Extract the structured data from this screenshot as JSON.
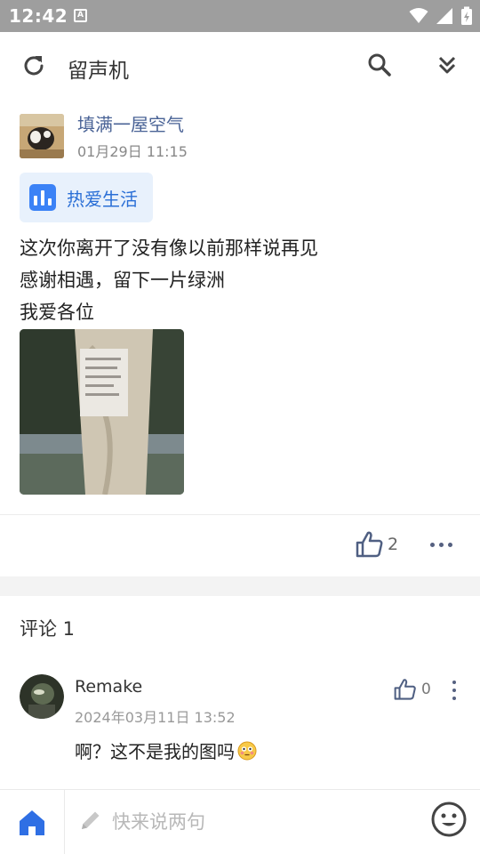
{
  "status_bar": {
    "time": "12:42",
    "notification_letter": "A"
  },
  "app_bar": {
    "title": "留声机"
  },
  "post": {
    "author": "填满一屋空气",
    "time": "01月29日 11:15",
    "topic": "热爱生活",
    "lines": [
      "这次你离开了没有像以前那样说再见",
      "感谢相遇，留下一片绿洲",
      "我爱各位"
    ],
    "like_count": "2"
  },
  "comments": {
    "header": "评论 1",
    "items": [
      {
        "author": "Remake",
        "time": "2024年03月11日 13:52",
        "text": "啊？这不是我的图吗",
        "like_count": "0"
      }
    ]
  },
  "bottom_bar": {
    "input_placeholder": "快来说两句"
  },
  "colors": {
    "accent": "#3b82f6",
    "author_link": "#4a6396",
    "tag_bg": "#e8f1fc",
    "icon_gray": "#556080"
  },
  "icons": [
    "refresh-icon",
    "search-icon",
    "double-chevron-down-icon",
    "thumbs-up-icon",
    "more-horizontal-icon",
    "more-vertical-icon",
    "home-icon",
    "pencil-icon",
    "emoji-icon",
    "chart-icon"
  ]
}
